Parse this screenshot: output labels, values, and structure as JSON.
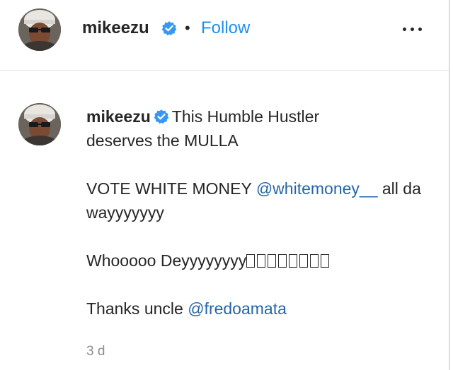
{
  "header": {
    "username": "mikeezu",
    "separator": "•",
    "follow_label": "Follow",
    "more_icon": "more-horizontal-icon",
    "verified_icon": "verified-badge-icon"
  },
  "comment": {
    "username": "mikeezu",
    "line1_text": "This Humble Hustler",
    "line2_text": "deserves the MULLA",
    "vote_text_before": "VOTE WHITE MONEY ",
    "vote_mention": "@whitemoney__",
    "vote_text_after": " all da wayyyyyyy",
    "whoo_text": "Whooooo Deyyyyyyyy",
    "emoji_count": 8,
    "thanks_text": "Thanks uncle ",
    "thanks_mention": "@fredoamata",
    "timestamp": "3 d"
  },
  "colors": {
    "link": "#1e8ef0",
    "mention": "#2467a8",
    "muted": "#8e8e8e",
    "verified": "#3897f0"
  }
}
